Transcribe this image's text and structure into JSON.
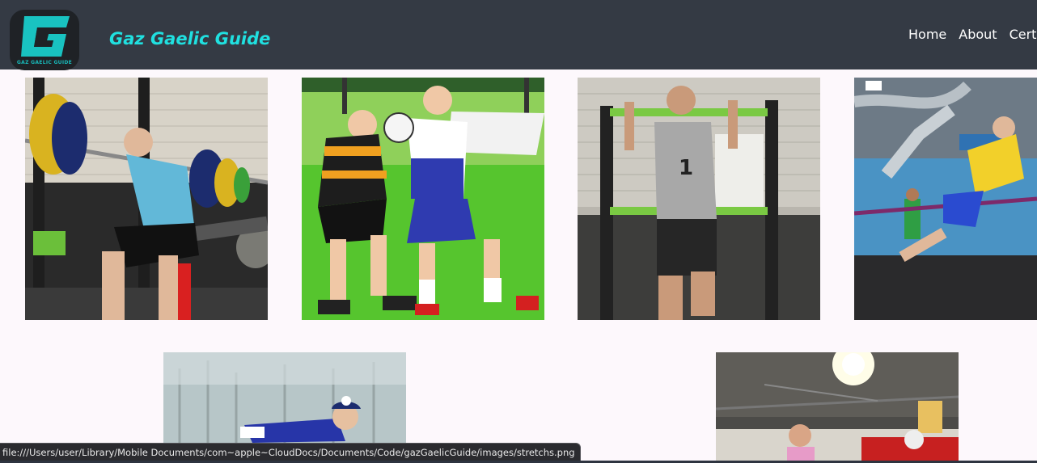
{
  "navbar": {
    "brand": "Gaz Gaelic Guide",
    "logo_caption": "GAZ GAELIC GUIDE",
    "links": [
      "Home",
      "About",
      "Certif"
    ]
  },
  "gallery": {
    "images": [
      "squat-training-photo",
      "gaelic-football-match-photo",
      "pull-up-training-photo",
      "resistance-band-jump-photo",
      "outdoor-dive-stretch-photo",
      "indoor-gym-photo"
    ]
  },
  "statusbar": {
    "url": "file:///Users/user/Library/Mobile Documents/com~apple~CloudDocs/Documents/Code/gazGaelicGuide/images/stretchs.png"
  },
  "colors": {
    "navbar_bg": "#343a44",
    "brand": "#20e0e0",
    "page_bg": "#fdf8fc"
  }
}
